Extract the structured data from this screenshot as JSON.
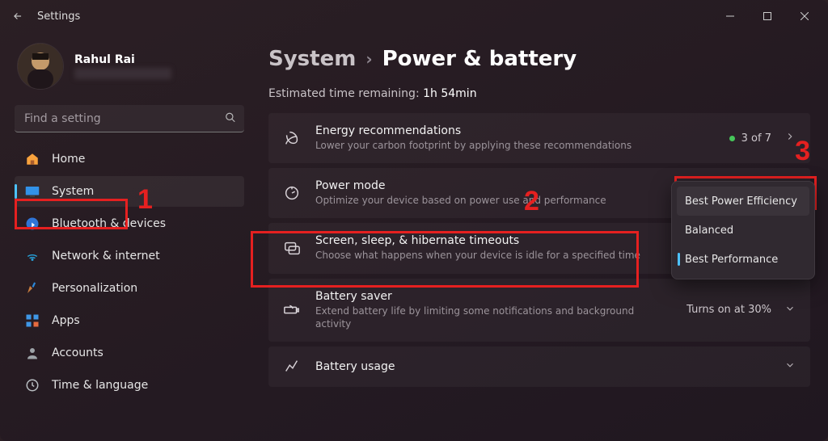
{
  "window": {
    "title": "Settings"
  },
  "profile": {
    "name": "Rahul Rai"
  },
  "search": {
    "placeholder": "Find a setting"
  },
  "nav": {
    "items": [
      {
        "label": "Home"
      },
      {
        "label": "System"
      },
      {
        "label": "Bluetooth & devices"
      },
      {
        "label": "Network & internet"
      },
      {
        "label": "Personalization"
      },
      {
        "label": "Apps"
      },
      {
        "label": "Accounts"
      },
      {
        "label": "Time & language"
      }
    ]
  },
  "breadcrumb": {
    "root": "System",
    "leaf": "Power & battery"
  },
  "estimated": {
    "label": "Estimated time remaining:",
    "value": "1h 54min"
  },
  "cards": {
    "energy": {
      "title": "Energy recommendations",
      "desc": "Lower your carbon footprint by applying these recommendations",
      "counter": "3 of 7"
    },
    "power_mode": {
      "title": "Power mode",
      "desc": "Optimize your device based on power use and performance"
    },
    "screen": {
      "title": "Screen, sleep, & hibernate timeouts",
      "desc": "Choose what happens when your device is idle for a specified time"
    },
    "battery_saver": {
      "title": "Battery saver",
      "desc": "Extend battery life by limiting some notifications and background activity",
      "right": "Turns on at 30%"
    },
    "battery_usage": {
      "title": "Battery usage"
    }
  },
  "dropdown": {
    "options": [
      "Best Power Efficiency",
      "Balanced",
      "Best Performance"
    ]
  },
  "annotations": {
    "one": "1",
    "two": "2",
    "three": "3"
  }
}
